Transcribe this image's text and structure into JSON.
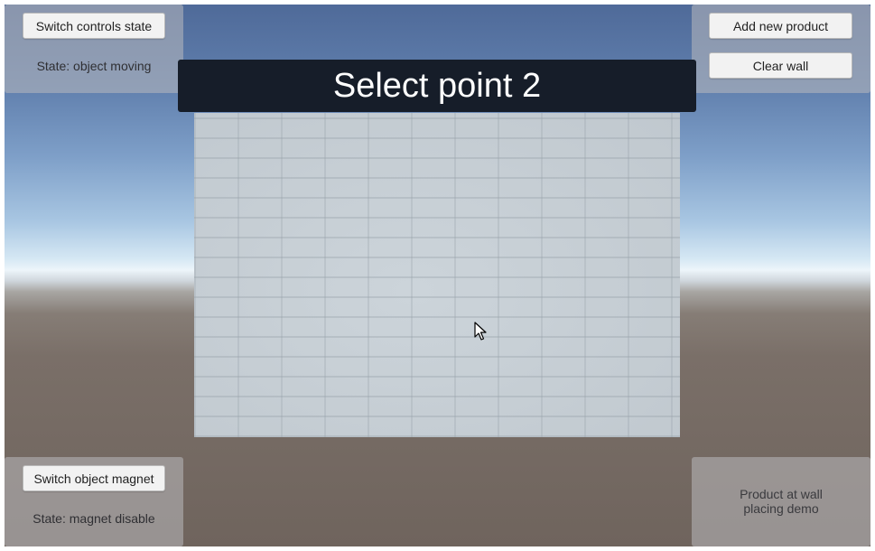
{
  "top_left_panel": {
    "switch_controls_label": "Switch controls state",
    "state_text": "State: object moving"
  },
  "top_right_panel": {
    "add_product_label": "Add new product",
    "clear_wall_label": "Clear wall"
  },
  "banner": {
    "text": "Select point 2"
  },
  "bottom_left_panel": {
    "switch_magnet_label": "Switch object magnet",
    "state_text": "State: magnet disable"
  },
  "bottom_right_panel": {
    "caption_line1": "Product at wall",
    "caption_line2": "placing demo"
  },
  "icons": {
    "cursor": "mouse-pointer-icon"
  }
}
